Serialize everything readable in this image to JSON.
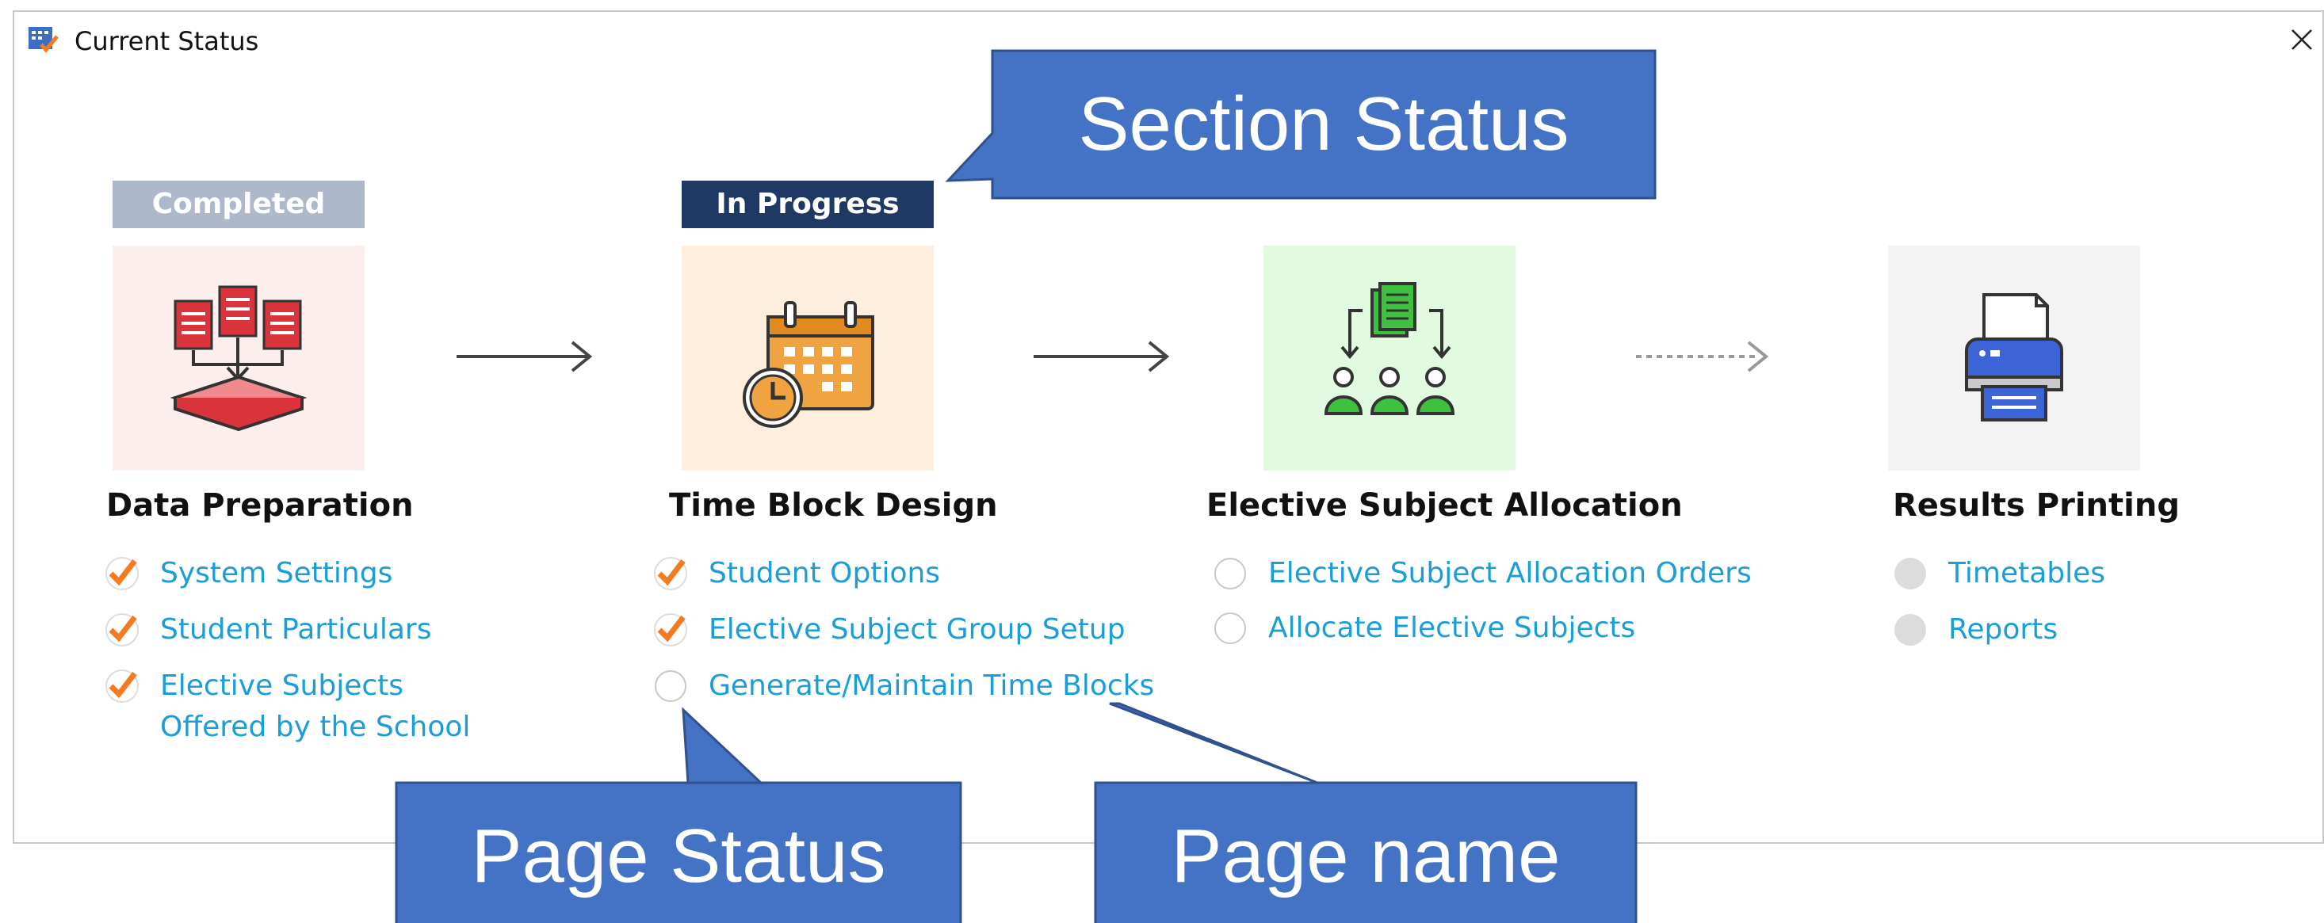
{
  "window": {
    "title": "Current Status",
    "app_icon": "timetable-app-icon",
    "close_icon": "close-icon"
  },
  "colors": {
    "link": "#1a9ed8",
    "check": "#f47b20",
    "completed_badge": "#adb9ca",
    "in_progress_badge": "#1f3864",
    "callout": "#4472c4",
    "callout_border": "#2f528f"
  },
  "sections": [
    {
      "badge": "Completed",
      "title": "Data Preparation",
      "icon": "documents-import-icon",
      "tile_color": "#fdeeee",
      "items": [
        {
          "label": "System Settings",
          "status": "done"
        },
        {
          "label": "Student Particulars",
          "status": "done"
        },
        {
          "label_line1": "Elective Subjects",
          "label_line2": "Offered by the School",
          "status": "done"
        }
      ]
    },
    {
      "badge": "In Progress",
      "title": "Time Block Design",
      "icon": "calendar-clock-icon",
      "tile_color": "#fdeedd",
      "items": [
        {
          "label": "Student Options",
          "status": "done"
        },
        {
          "label": "Elective Subject Group Setup",
          "status": "done"
        },
        {
          "label": "Generate/Maintain Time Blocks",
          "status": "not-started"
        }
      ]
    },
    {
      "title": "Elective Subject Allocation",
      "icon": "group-allocation-icon",
      "tile_color": "#e2fbe0",
      "items": [
        {
          "label": "Elective Subject Allocation Orders",
          "status": "not-started"
        },
        {
          "label": "Allocate Elective Subjects",
          "status": "not-started"
        }
      ]
    },
    {
      "title": "Results Printing",
      "icon": "printer-icon",
      "tile_color": "#f3f3f3",
      "items": [
        {
          "label": "Timetables",
          "status": "disabled"
        },
        {
          "label": "Reports",
          "status": "disabled"
        }
      ]
    }
  ],
  "flow_arrows": [
    "solid",
    "solid",
    "dashed"
  ],
  "callouts": {
    "section_status": "Section Status",
    "page_status": "Page Status",
    "page_name": "Page name"
  }
}
